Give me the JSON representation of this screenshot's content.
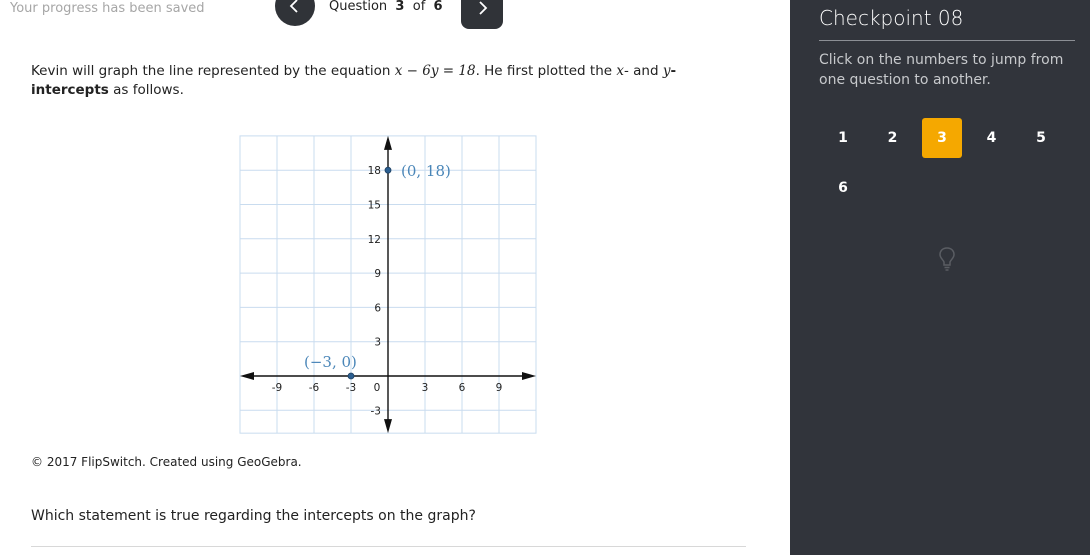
{
  "header": {
    "saved_text": "Your progress has been saved",
    "question_label": "Question",
    "current": "3",
    "of_label": "of",
    "total": "6"
  },
  "question": {
    "part1": "Kevin will graph the line represented by the equation ",
    "equation": "x − 6y = 18",
    "part2": ". He first plotted the ",
    "x_var": "x",
    "part3": "- and ",
    "y_var": "y",
    "part4": "-intercepts",
    "part5": " as follows."
  },
  "graph": {
    "x_ticks": [
      "-9",
      "-6",
      "-3",
      "0",
      "3",
      "6",
      "9"
    ],
    "y_ticks": [
      "18",
      "15",
      "12",
      "9",
      "6",
      "3",
      "-3"
    ],
    "points": [
      {
        "label": "(0, 18)",
        "x": 0,
        "y": 18
      },
      {
        "label": "(−3, 0)",
        "x": -3,
        "y": 0
      }
    ]
  },
  "copyright": "© 2017 FlipSwitch. Created using GeoGebra.",
  "prompt": "Which statement is true regarding the intercepts on the graph?",
  "sidebar": {
    "title": "Checkpoint 08",
    "hint": "Click on the numbers to jump from one question to another.",
    "questions": [
      "1",
      "2",
      "3",
      "4",
      "5",
      "6"
    ],
    "active_index": 2,
    "active_color": "#f5a800"
  },
  "colors": {
    "sidebar_bg": "#31343b",
    "point_label": "#4a86b8"
  }
}
